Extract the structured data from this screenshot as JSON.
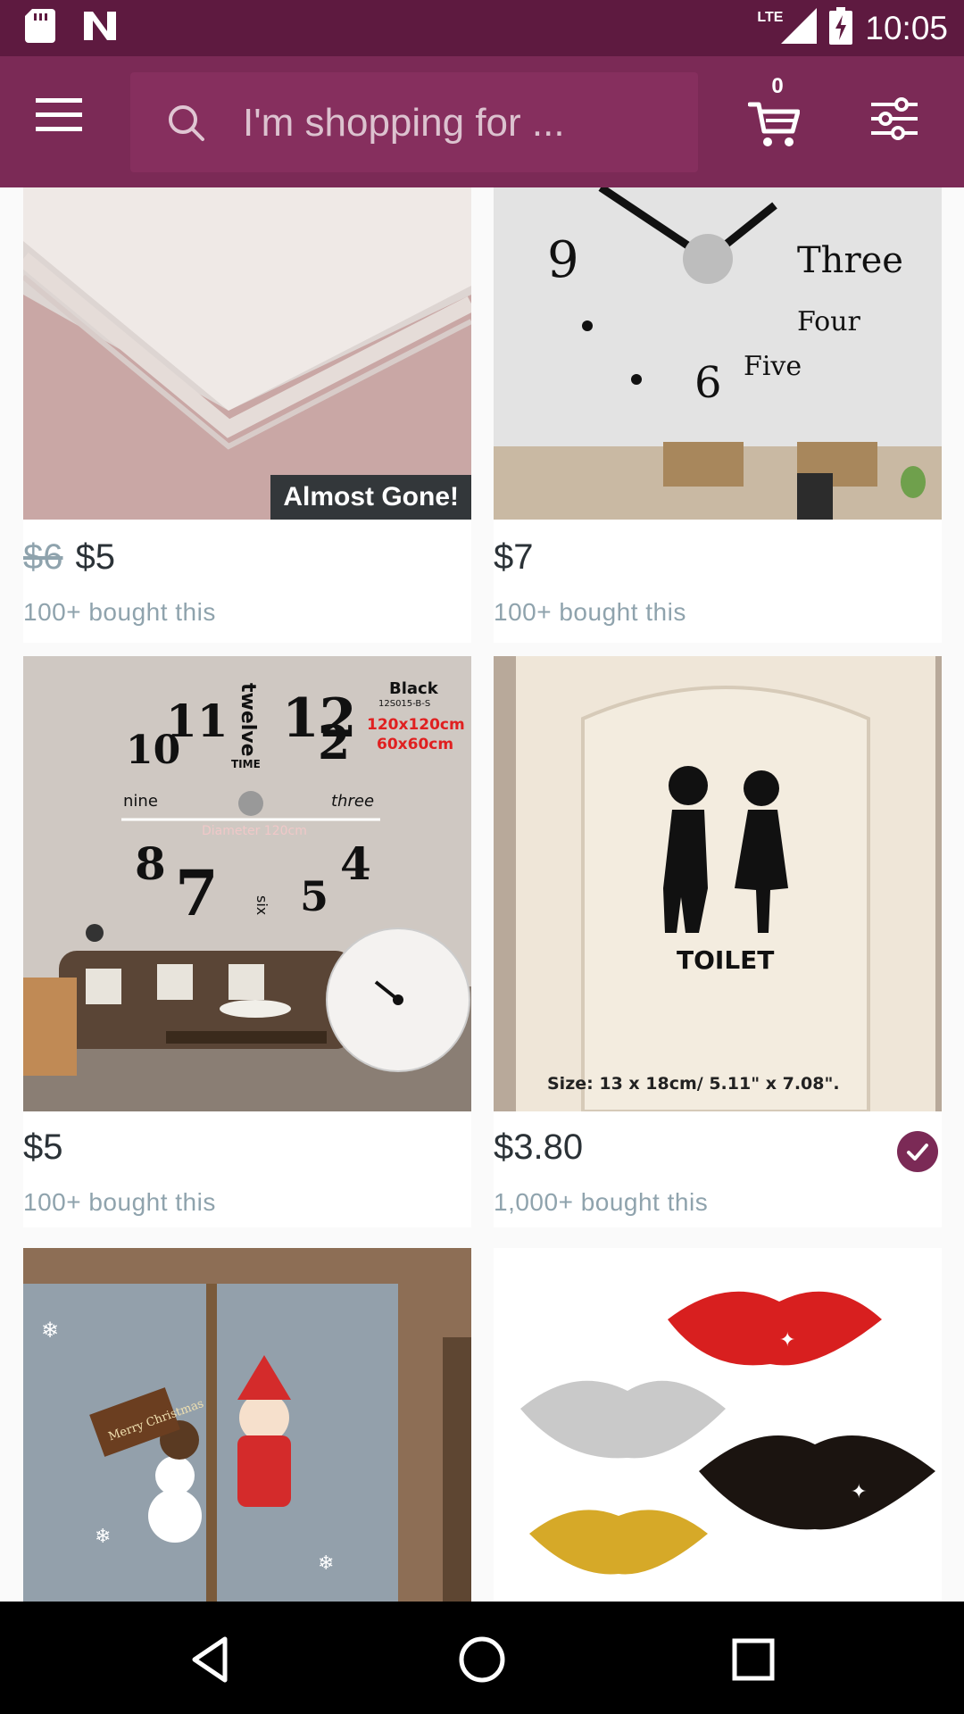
{
  "status_bar": {
    "network": "LTE",
    "time": "10:05"
  },
  "search": {
    "placeholder": "I'm shopping for ..."
  },
  "cart": {
    "count": "0"
  },
  "products": [
    {
      "old_price": "$6",
      "price": "$5",
      "bought": "100+ bought this",
      "badge": "Almost Gone!"
    },
    {
      "price": "$7",
      "bought": "100+ bought this",
      "image_text": [
        "9",
        "Three",
        "Four",
        "6",
        "Five"
      ]
    },
    {
      "price": "$5",
      "bought": "100+ bought this",
      "image_text": {
        "variant": "Black",
        "sku": "12S015-B-S",
        "size1": "120x120cm",
        "size2": "60x60cm",
        "diameter": "Diameter 120cm",
        "numbers": [
          "11",
          "12",
          "10",
          "2",
          "8",
          "4",
          "7",
          "5"
        ],
        "words": [
          "twelve",
          "nine",
          "three",
          "TIME",
          "six"
        ]
      }
    },
    {
      "price": "$3.80",
      "bought": "1,000+ bought this",
      "wishlisted": true,
      "image_text": {
        "label": "TOILET",
        "size": "Size: 13 x 18cm/ 5.11\" x 7.08\"."
      }
    },
    {
      "image_text": {
        "sign": "Merry Christmas"
      }
    },
    {}
  ],
  "colors": {
    "status_bar": "#5e1a40",
    "toolbar": "#7b2a56",
    "accent": "#7b2a56",
    "price_text": "#2b3237",
    "muted_text": "#8fa3ad"
  },
  "icons": {
    "menu": "hamburger-icon",
    "search": "search-icon",
    "cart": "cart-icon",
    "filter": "filter-sliders-icon",
    "back": "back-triangle-icon",
    "home": "home-circle-icon",
    "recents": "recents-square-icon"
  }
}
